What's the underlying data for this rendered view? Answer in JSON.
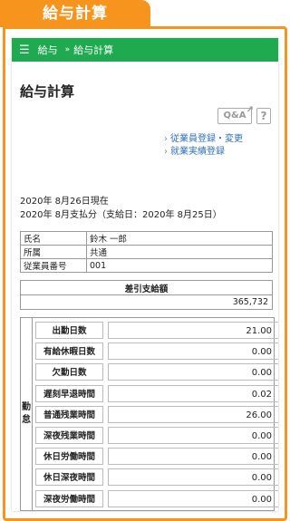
{
  "tab": {
    "title": "給与計算"
  },
  "header": {
    "breadcrumb_root": "給与",
    "breadcrumb_sep": "»",
    "breadcrumb_current": "給与計算"
  },
  "page": {
    "title": "給与計算",
    "qa_label": "Q&A",
    "help_label": "?"
  },
  "links": [
    {
      "label": "従業員登録・変更"
    },
    {
      "label": "就業実績登録"
    }
  ],
  "dates": {
    "as_of": "2020年 8月26日現在",
    "payment": "2020年 8月支払分（支給日：2020年 8月25日）"
  },
  "employee": {
    "rows": [
      {
        "label": "氏名",
        "value": "鈴木 一郎"
      },
      {
        "label": "所属",
        "value": "共通"
      },
      {
        "label": "従業員番号",
        "value": "001"
      }
    ]
  },
  "net_pay": {
    "label": "差引支給額",
    "value": "365,732"
  },
  "attendance": {
    "side_label_1": "勤",
    "side_label_2": "怠",
    "rows": [
      {
        "label": "出勤日数",
        "value": "21.00"
      },
      {
        "label": "有給休暇日数",
        "value": "0.00"
      },
      {
        "label": "欠勤日数",
        "value": "0.00"
      },
      {
        "label": "遅刻早退時間",
        "value": "0.02"
      },
      {
        "label": "普通残業時間",
        "value": "26.00"
      },
      {
        "label": "深夜残業時間",
        "value": "0.00"
      },
      {
        "label": "休日労働時間",
        "value": "0.00"
      },
      {
        "label": "休日深夜時間",
        "value": "0.00"
      },
      {
        "label": "深夜労働時間",
        "value": "0.00"
      }
    ]
  }
}
